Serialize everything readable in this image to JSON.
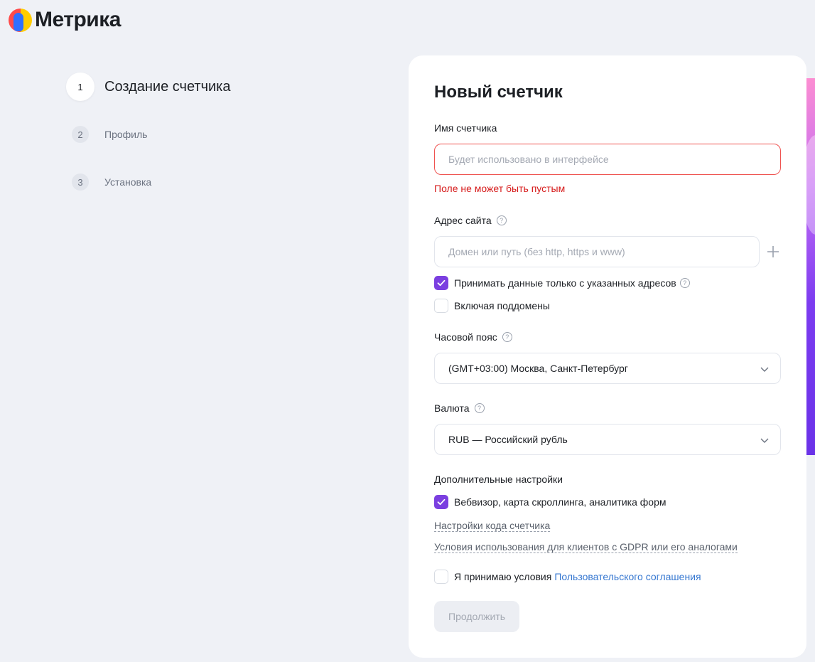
{
  "app": {
    "logo_text": "Метрика"
  },
  "steps": [
    {
      "num": "1",
      "label": "Создание счетчика"
    },
    {
      "num": "2",
      "label": "Профиль"
    },
    {
      "num": "3",
      "label": "Установка"
    }
  ],
  "form": {
    "title": "Новый счетчик",
    "name_label": "Имя счетчика",
    "name_placeholder": "Будет использовано в интерфейсе",
    "name_error": "Поле не может быть пустым",
    "site_label": "Адрес сайта",
    "site_placeholder": "Домен или путь (без http, https и www)",
    "accept_only_label": "Принимать данные только с указанных адресов",
    "subdomains_label": "Включая поддомены",
    "timezone_label": "Часовой пояс",
    "timezone_value": "(GMT+03:00) Москва, Санкт-Петербург",
    "currency_label": "Валюта",
    "currency_value": "RUB — Российский рубль",
    "extra_label": "Дополнительные настройки",
    "webvisor_label": "Вебвизор, карта скроллинга, аналитика форм",
    "code_settings_link": "Настройки кода счетчика",
    "gdpr_link": "Условия использования для клиентов с GDPR или его аналогами",
    "agree_prefix": "Я принимаю условия",
    "agree_link": "Пользовательского соглашения",
    "continue_button": "Продолжить"
  },
  "icons": {
    "help": "?"
  }
}
